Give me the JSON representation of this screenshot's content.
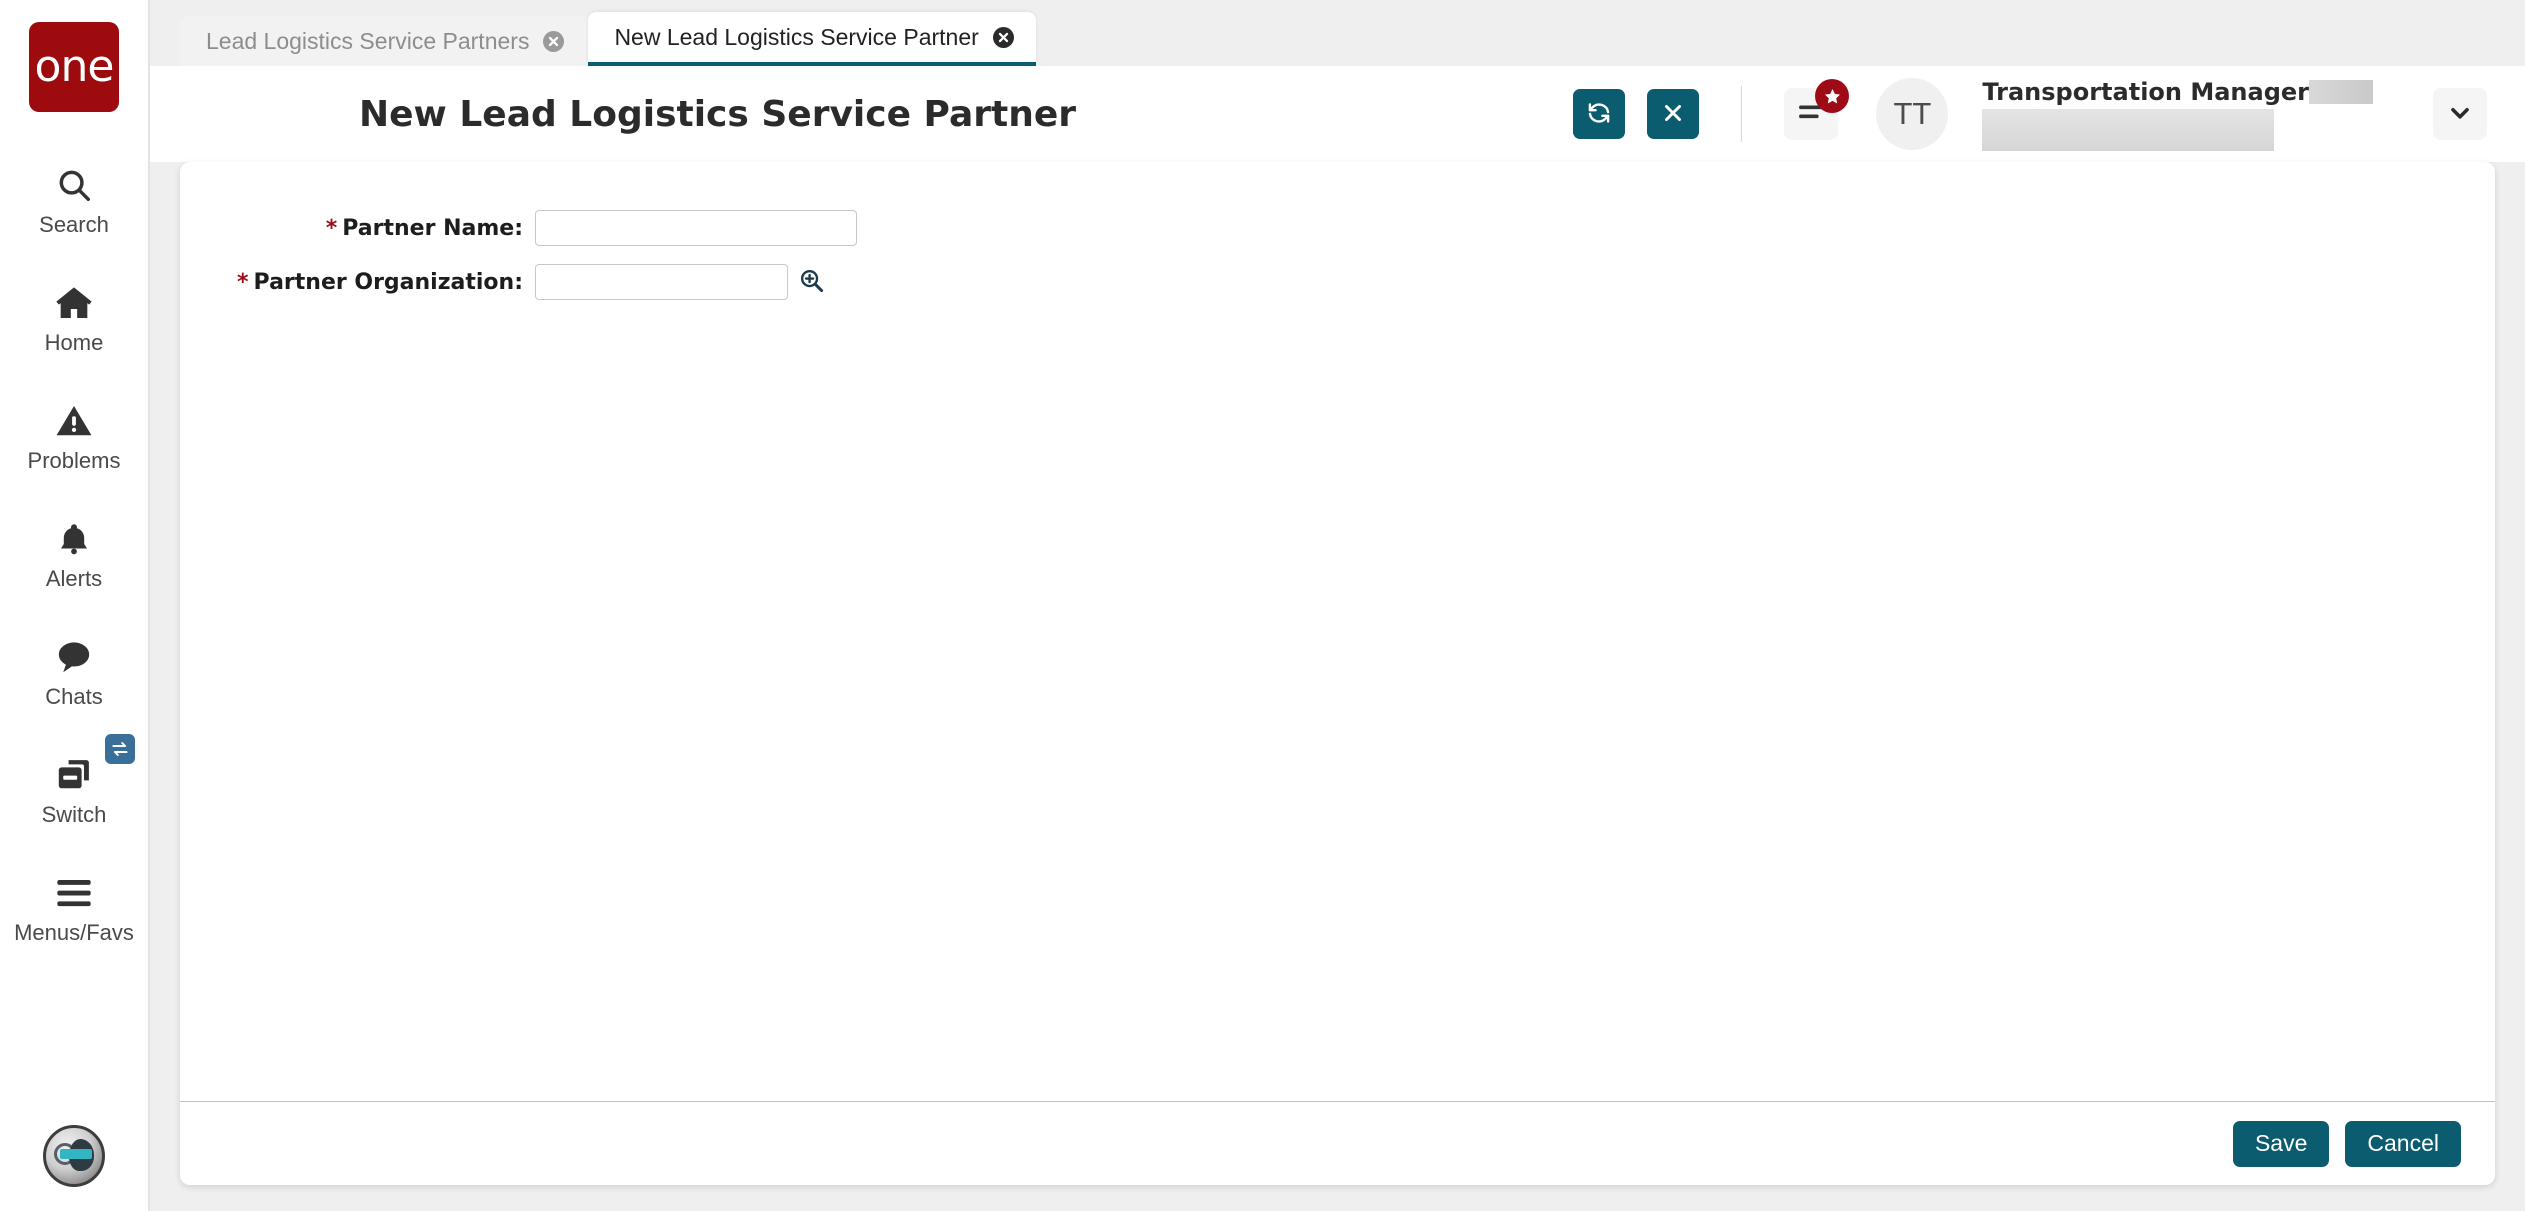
{
  "brand": {
    "logo_text": "one",
    "logo_color": "#9e0b0f",
    "accent_teal": "#0c5c70",
    "badge_red": "#9e0b16"
  },
  "sidebar": {
    "items": [
      {
        "label": "Search",
        "icon": "search-icon"
      },
      {
        "label": "Home",
        "icon": "home-icon"
      },
      {
        "label": "Problems",
        "icon": "warning-triangle-icon"
      },
      {
        "label": "Alerts",
        "icon": "bell-icon"
      },
      {
        "label": "Chats",
        "icon": "chat-bubble-icon"
      },
      {
        "label": "Switch",
        "icon": "switch-cards-icon"
      },
      {
        "label": "Menus/Favs",
        "icon": "hamburger-menu-icon"
      }
    ],
    "assistant_avatar": "robot-assistant-icon"
  },
  "tabs": [
    {
      "label": "Lead Logistics Service Partners",
      "active": false,
      "close_icon": "close-circle-icon"
    },
    {
      "label": "New Lead Logistics Service Partner",
      "active": true,
      "close_icon": "close-circle-icon"
    }
  ],
  "header": {
    "title": "New Lead Logistics Service Partner",
    "refresh_icon": "refresh-icon",
    "close_icon": "close-x-icon",
    "menu_icon": "list-menu-icon",
    "menu_badge_icon": "star-icon",
    "avatar_initials": "TT",
    "user_role": "Transportation Manager",
    "user_name_redacted": "",
    "user_detail_redacted": "",
    "chevron_icon": "chevron-down-icon"
  },
  "form": {
    "fields": [
      {
        "label": "Partner Name:",
        "required_marker": "*",
        "value": "",
        "placeholder": ""
      },
      {
        "label": "Partner Organization:",
        "required_marker": "*",
        "value": "",
        "placeholder": "",
        "lookup_icon": "search-plus-icon"
      }
    ]
  },
  "footer": {
    "save_label": "Save",
    "cancel_label": "Cancel"
  }
}
